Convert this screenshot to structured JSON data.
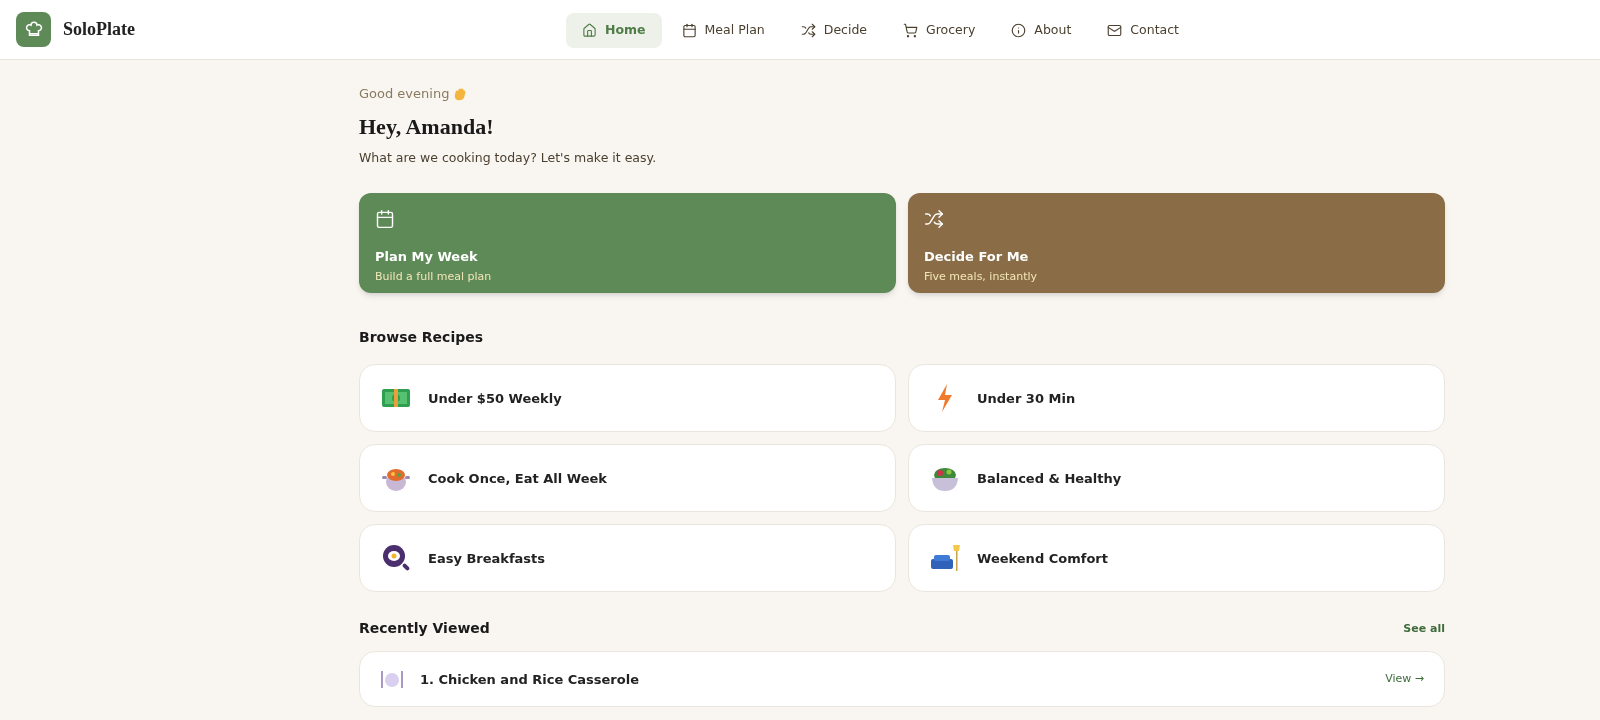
{
  "brand": {
    "name": "SoloPlate"
  },
  "nav": [
    {
      "label": "Home",
      "kind": "home",
      "selected": true
    },
    {
      "label": "Meal Plan",
      "kind": "calendar",
      "selected": false
    },
    {
      "label": "Decide",
      "kind": "shuffle",
      "selected": false
    },
    {
      "label": "Grocery",
      "kind": "cart",
      "selected": false
    },
    {
      "label": "About",
      "kind": "info",
      "selected": false
    },
    {
      "label": "Contact",
      "kind": "mail",
      "selected": false
    }
  ],
  "greeting": "Good evening",
  "title": "Hey, Amanda!",
  "subtitle": "What are we cooking today? Let's make it easy.",
  "actions": [
    {
      "title": "Plan My Week",
      "subtitle": "Build a full meal plan",
      "kind": "calendar",
      "color": "#5e8a57"
    },
    {
      "title": "Decide For Me",
      "subtitle": "Five meals, instantly",
      "kind": "shuffle",
      "color": "#8a6d47"
    }
  ],
  "browse": {
    "heading": "Browse Recipes",
    "items": [
      {
        "label": "Under $50 Weekly",
        "kind": "money"
      },
      {
        "label": "Under 30 Min",
        "kind": "bolt"
      },
      {
        "label": "Cook Once, Eat All Week",
        "kind": "pot"
      },
      {
        "label": "Balanced & Healthy",
        "kind": "salad"
      },
      {
        "label": "Easy Breakfasts",
        "kind": "pan"
      },
      {
        "label": "Weekend Comfort",
        "kind": "couch"
      }
    ]
  },
  "recent": {
    "heading": "Recently Viewed",
    "see_all": "See all",
    "items": [
      {
        "title": "1. Chicken and Rice Casserole",
        "action": "View →"
      }
    ]
  }
}
